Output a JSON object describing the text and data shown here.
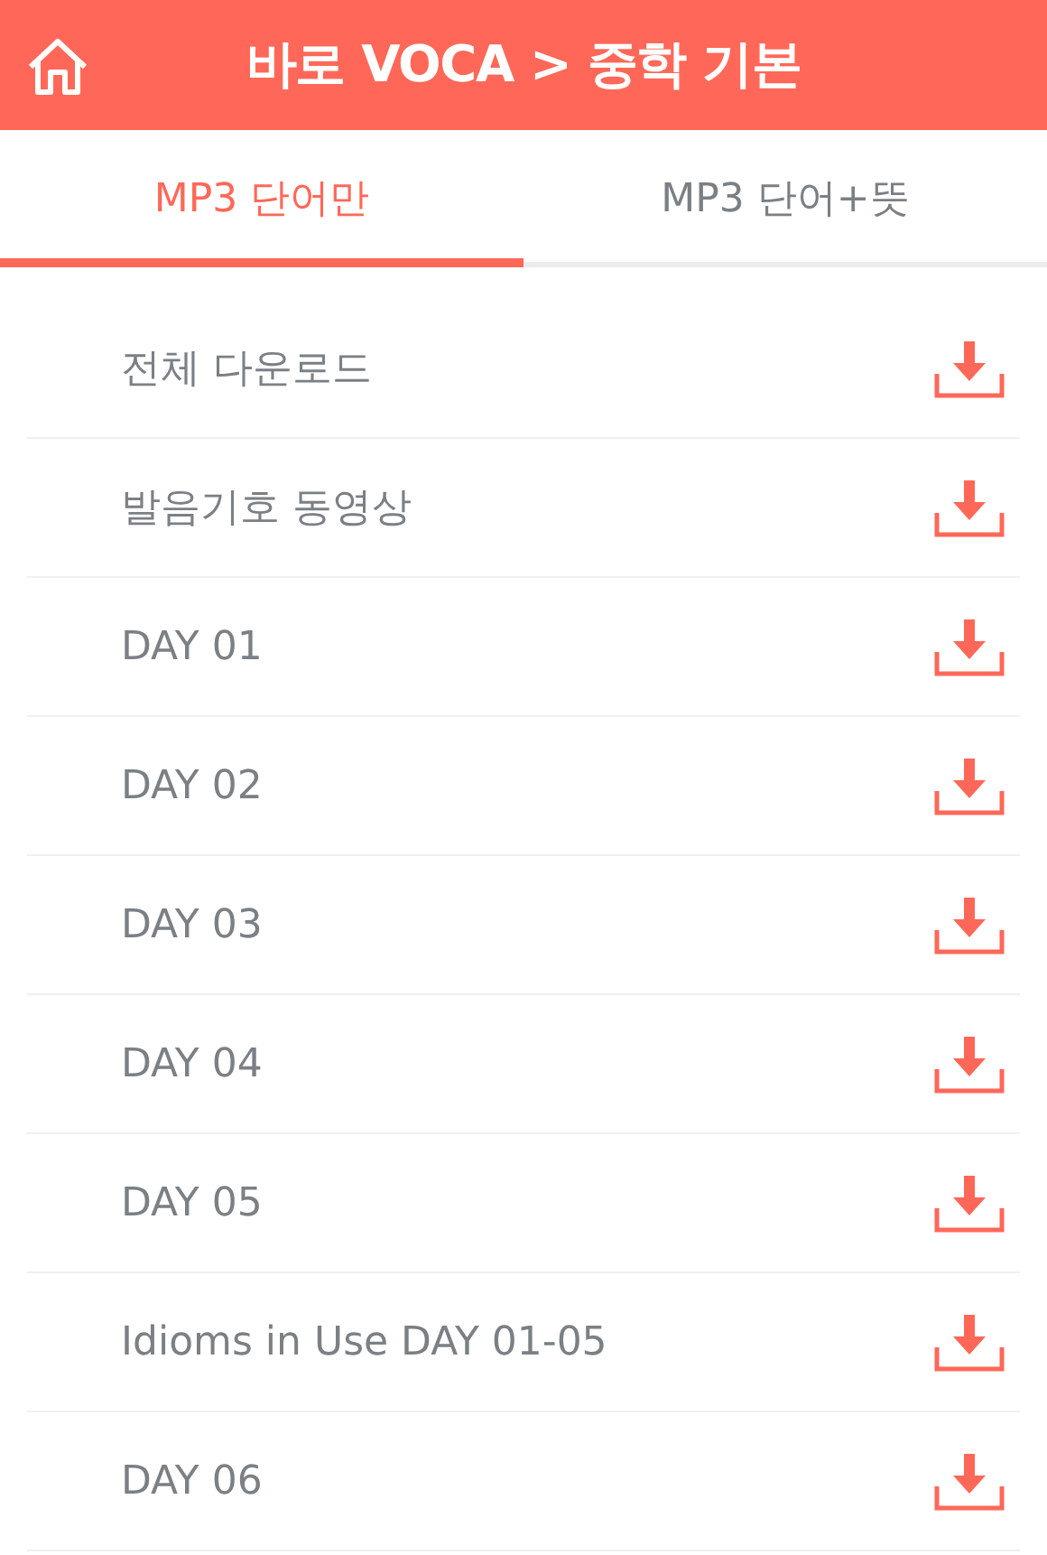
{
  "header": {
    "title": "바로 VOCA > 중학 기본"
  },
  "tabs": [
    {
      "label": "MP3 단어만",
      "selected": true
    },
    {
      "label": "MP3 단어+뜻",
      "selected": false
    }
  ],
  "items": [
    {
      "label": "전체 다운로드"
    },
    {
      "label": "발음기호 동영상"
    },
    {
      "label": "DAY 01"
    },
    {
      "label": "DAY 02"
    },
    {
      "label": "DAY 03"
    },
    {
      "label": "DAY 04"
    },
    {
      "label": "DAY 05"
    },
    {
      "label": "Idioms in Use DAY 01-05"
    },
    {
      "label": "DAY 06"
    }
  ]
}
